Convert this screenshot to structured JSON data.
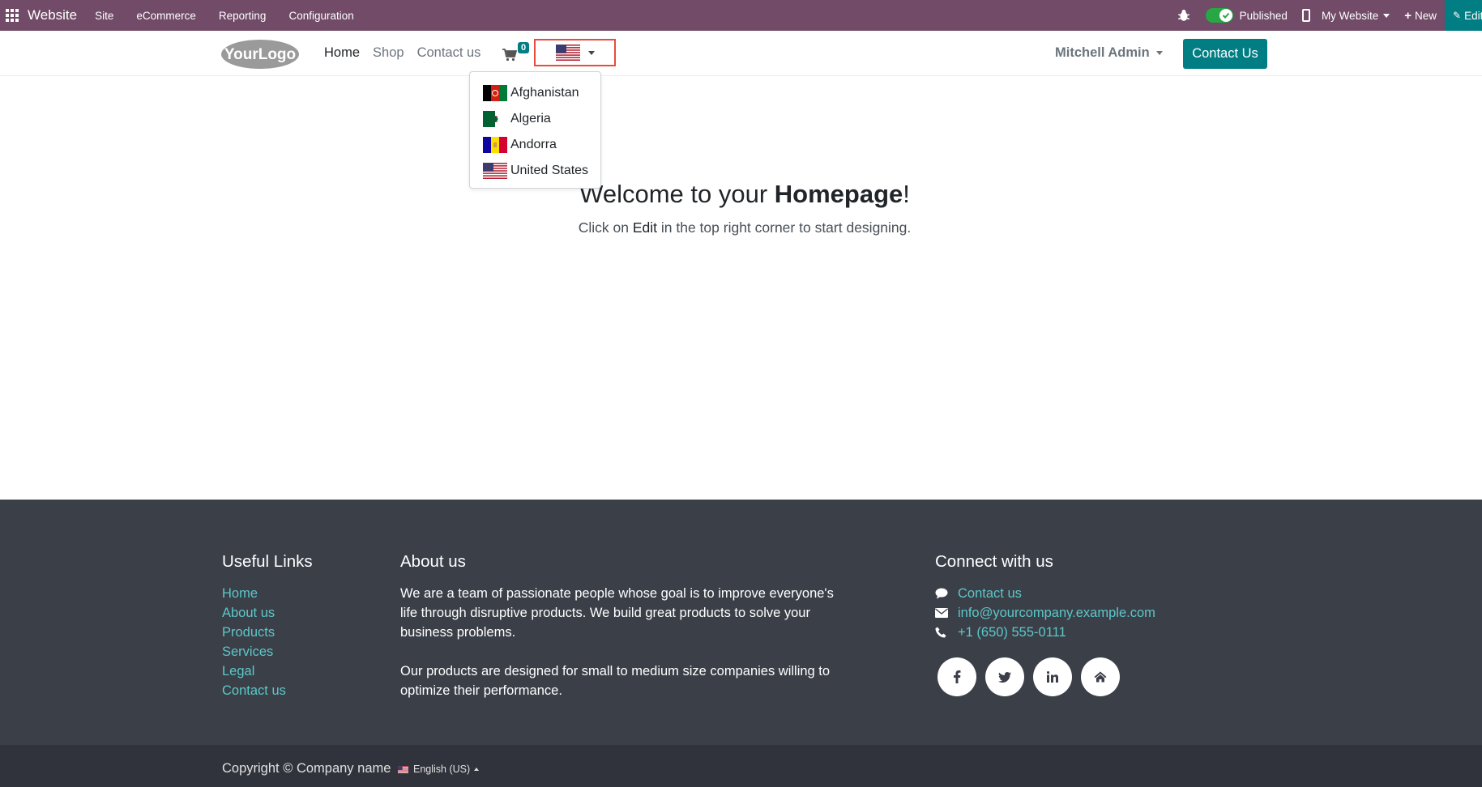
{
  "adminbar": {
    "brand": "Website",
    "menu": [
      "Site",
      "eCommerce",
      "Reporting",
      "Configuration"
    ],
    "published_label": "Published",
    "my_website_label": "My Website",
    "new_label": "New",
    "edit_label": "Edit",
    "color": "#714b67"
  },
  "header": {
    "logo_text": "YourLogo",
    "nav": [
      "Home",
      "Shop",
      "Contact us"
    ],
    "cart_count": "0",
    "user_name": "Mitchell Admin",
    "contact_button": "Contact Us",
    "accent_color": "#017e84"
  },
  "country_dropdown": {
    "selected": "united-states-flag-icon",
    "options": [
      "Afghanistan",
      "Algeria",
      "Andorra",
      "United States"
    ]
  },
  "main": {
    "welcome_prefix": "Welcome to your ",
    "welcome_bold": "Homepage",
    "welcome_suffix": "!",
    "sub_prefix": "Click on ",
    "sub_edit": "Edit",
    "sub_suffix": " in the top right corner to start designing."
  },
  "footer": {
    "useful_links_title": "Useful Links",
    "useful_links": [
      "Home",
      "About us",
      "Products",
      "Services",
      "Legal",
      "Contact us"
    ],
    "about_title": "About us",
    "about_p1": "We are a team of passionate people whose goal is to improve everyone's life through disruptive products. We build great products to solve your business problems.",
    "about_p2": "Our products are designed for small to medium size companies willing to optimize their performance.",
    "connect_title": "Connect with us",
    "connect_contact": "Contact us",
    "connect_email": "info@yourcompany.example.com",
    "connect_phone": "+1 (650) 555-0111",
    "socials": [
      "facebook-icon",
      "twitter-icon",
      "linkedin-icon",
      "home-icon"
    ]
  },
  "copyright": {
    "text": "Copyright © Company name",
    "language": "English (US)"
  }
}
